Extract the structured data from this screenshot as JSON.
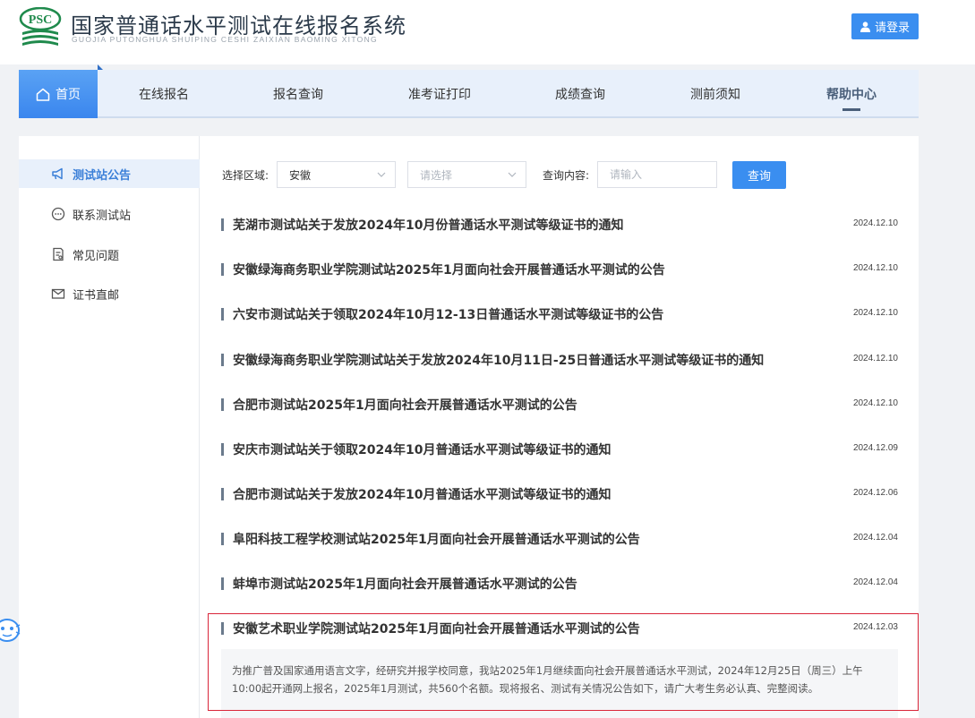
{
  "header": {
    "logo_text": "PSC",
    "title": "国家普通话水平测试在线报名系统",
    "subtitle": "GUOJIA PUTONGHUA SHUIPING CESHI ZAIXIAN BAOMING XITONG",
    "login_label": "请登录",
    "login_icon": "user-icon"
  },
  "nav": {
    "home_label": "首页",
    "home_icon": "home-icon",
    "items": [
      "在线报名",
      "报名查询",
      "准考证打印",
      "成绩查询",
      "测前须知",
      "帮助中心"
    ],
    "active_index": 5
  },
  "sidebar": {
    "items": [
      {
        "label": "测试站公告",
        "icon": "megaphone-icon"
      },
      {
        "label": "联系测试站",
        "icon": "chat-icon"
      },
      {
        "label": "常见问题",
        "icon": "document-icon"
      },
      {
        "label": "证书直邮",
        "icon": "mail-icon"
      }
    ],
    "active_index": 0
  },
  "filters": {
    "region_label": "选择区域:",
    "region_value": "安徽",
    "city_placeholder": "请选择",
    "query_label": "查询内容:",
    "query_placeholder": "请输入",
    "search_label": "查询"
  },
  "notices": [
    {
      "title": "芜湖市测试站关于发放2024年10月份普通话水平测试等级证书的通知",
      "date": "2024.12.10"
    },
    {
      "title": "安徽绿海商务职业学院测试站2025年1月面向社会开展普通话水平测试的公告",
      "date": "2024.12.10"
    },
    {
      "title": "六安市测试站关于领取2024年10月12-13日普通话水平测试等级证书的公告",
      "date": "2024.12.10"
    },
    {
      "title": "安徽绿海商务职业学院测试站关于发放2024年10月11日-25日普通话水平测试等级证书的通知",
      "date": "2024.12.10"
    },
    {
      "title": "合肥市测试站2025年1月面向社会开展普通话水平测试的公告",
      "date": "2024.12.10"
    },
    {
      "title": "安庆市测试站关于领取2024年10月普通话水平测试等级证书的通知",
      "date": "2024.12.09"
    },
    {
      "title": "合肥市测试站关于发放2024年10月普通话水平测试等级证书的通知",
      "date": "2024.12.06"
    },
    {
      "title": "阜阳科技工程学校测试站2025年1月面向社会开展普通话水平测试的公告",
      "date": "2024.12.04"
    },
    {
      "title": "蚌埠市测试站2025年1月面向社会开展普通话水平测试的公告",
      "date": "2024.12.04"
    },
    {
      "title": "安徽艺术职业学院测试站2025年1月面向社会开展普通话水平测试的公告",
      "date": "2024.12.03"
    }
  ],
  "expanded_excerpt": "为推广普及国家通用语言文字，经研究并报学校同意，我站2025年1月继续面向社会开展普通话水平测试，2024年12月25日（周三）上午10:00起开通网上报名，2025年1月测试，共560个名额。现将报名、测试有关情况公告如下，请广大考生务必认真、完整阅读。"
}
